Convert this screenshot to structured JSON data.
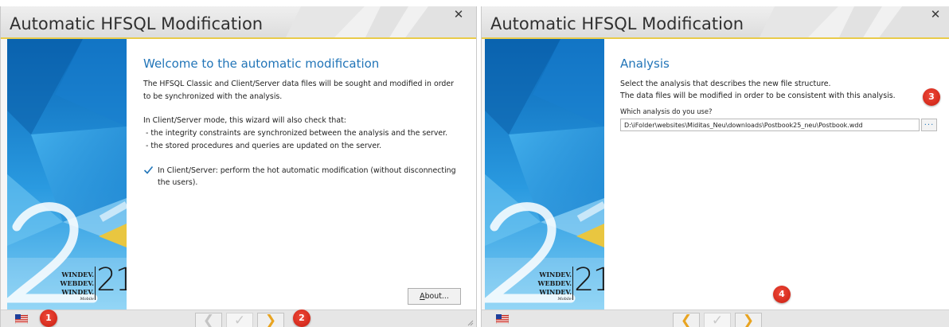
{
  "left_window": {
    "title": "Automatic HFSQL Modification",
    "close_glyph": "✕",
    "heading": "Welcome to the automatic modification",
    "intro": "The HFSQL Classic and Client/Server data files will be sought and modified in order\nto be synchronized with the analysis.",
    "checks_intro": "In Client/Server mode, this wizard will also check that:\n - the integrity constraints are synchronized between the analysis and the server.\n - the stored procedures and queries are updated on the server.",
    "checkbox": {
      "checked": true,
      "label": "In Client/Server: perform the hot automatic modification (without disconnecting the users)."
    },
    "about_button": {
      "first": "A",
      "rest": "bout..."
    }
  },
  "right_window": {
    "title": "Automatic HFSQL Modification",
    "close_glyph": "✕",
    "heading": "Analysis",
    "description": "Select the analysis that describes the new file structure.\nThe data files will be modified in order to be consistent with this analysis.",
    "field_label": "Which analysis do you use?",
    "field_value": "D:\\iFolder\\websites\\Miditas_Neu\\downloads\\Postbook25_neu\\Postbook.wdd",
    "browse_label": "..."
  },
  "brand": {
    "lines": [
      "WINDEV.",
      "WEBDEV.",
      "WINDEV."
    ],
    "mobile": "Mobile",
    "version": "21"
  },
  "nav": {
    "prev_glyph": "❮",
    "finish_glyph": "✓",
    "next_glyph": "❯"
  },
  "callouts": [
    "1",
    "2",
    "3",
    "4"
  ],
  "icons": {
    "language": "language-flag-icon",
    "close": "close-icon",
    "prev": "chevron-left-icon",
    "finish": "checkmark-icon",
    "next": "chevron-right-icon",
    "resize": "resize-grip-icon"
  },
  "colors": {
    "heading": "#2275b8",
    "title_accent": "#e9cb4a",
    "next_arrow": "#e8a421",
    "prev_arrow_enabled": "#e8a421",
    "prev_arrow_disabled": "#c4c4c4",
    "badge": "#d42a1c"
  }
}
